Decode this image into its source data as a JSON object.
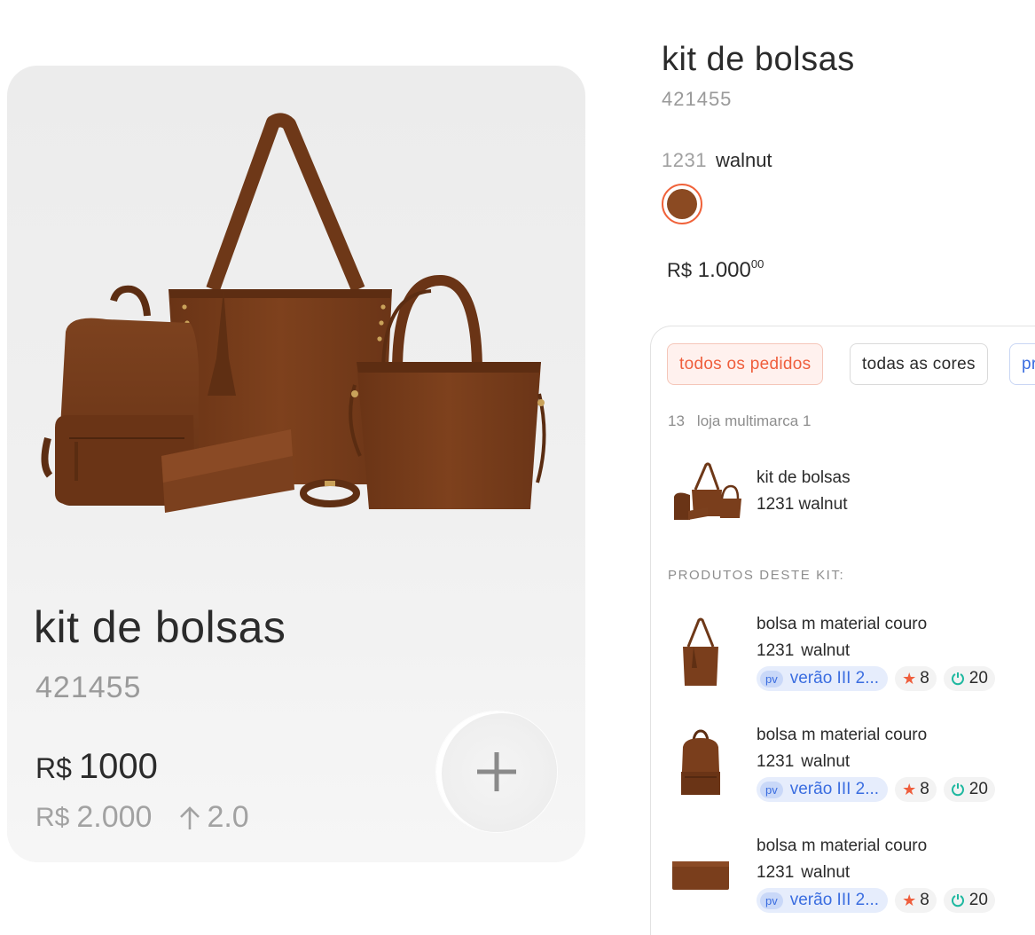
{
  "product": {
    "title": "kit de bolsas",
    "code": "421455",
    "price_currency": "R$",
    "price_value": "1000",
    "old_price_currency": "R$",
    "old_price_value": "2.000",
    "markup": "2.0",
    "add_icon": "plus-icon"
  },
  "details": {
    "title": "kit de bolsas",
    "code": "421455",
    "color_code": "1231",
    "color_name": "walnut",
    "swatch_color": "#8b4a22",
    "price_currency": "R$",
    "price_value": "1.000",
    "price_cents": "00"
  },
  "orders": {
    "filters": [
      "todos os pedidos",
      "todas as cores",
      "pr"
    ],
    "store_number": "13",
    "store_name": "loja multimarca 1",
    "order": {
      "name": "kit de bolsas",
      "color": "1231 walnut"
    },
    "kit_label": "PRODUTOS DESTE KIT:",
    "products": [
      {
        "name": "bolsa m material couro",
        "color_code": "1231",
        "color_name": "walnut",
        "badge": "pv",
        "season": "verão III 2...",
        "stars": "8",
        "stock": "20",
        "thumb": "tote-bag"
      },
      {
        "name": "bolsa m material couro",
        "color_code": "1231",
        "color_name": "walnut",
        "badge": "pv",
        "season": "verão III 2...",
        "stars": "8",
        "stock": "20",
        "thumb": "backpack"
      },
      {
        "name": "bolsa m material couro",
        "color_code": "1231",
        "color_name": "walnut",
        "badge": "pv",
        "season": "verão III 2...",
        "stars": "8",
        "stock": "20",
        "thumb": "wallet"
      }
    ]
  },
  "colors": {
    "accent": "#ef5e3c",
    "leather": "#7a3e1c",
    "blue": "#3a6de0"
  }
}
